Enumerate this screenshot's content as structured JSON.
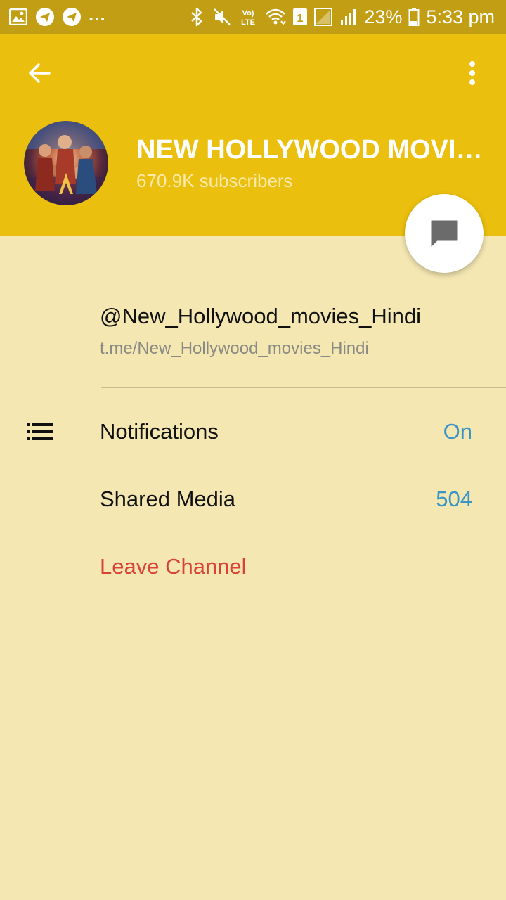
{
  "status_bar": {
    "left_icons": [
      "image-icon",
      "telegram-icon",
      "telegram-icon"
    ],
    "overflow": "...",
    "right_icons": [
      "bluetooth-icon",
      "mute-icon",
      "volte-icon",
      "wifi-icon",
      "sim-1-icon",
      "signal-empty-icon",
      "signal-icon",
      "battery-icon"
    ],
    "volte_label": "Vo) LTE",
    "sim_label": "1",
    "battery": "23%",
    "time": "5:33 pm"
  },
  "header": {
    "title": "NEW HOLLYWOOD MOVIES HINDI",
    "subscribers": "670.9K subscribers",
    "colors": {
      "bar": "#ebbf0e",
      "status": "#c29e14",
      "page": "#f4e7b2"
    }
  },
  "info": {
    "username": "@New_Hollywood_movies_Hindi",
    "link": "t.me/New_Hollywood_movies_Hindi"
  },
  "menu": {
    "notifications": {
      "label": "Notifications",
      "value": "On",
      "icon": "list-icon"
    },
    "shared_media": {
      "label": "Shared Media",
      "value": "504"
    },
    "leave": {
      "label": "Leave Channel",
      "color": "#d94337"
    }
  }
}
